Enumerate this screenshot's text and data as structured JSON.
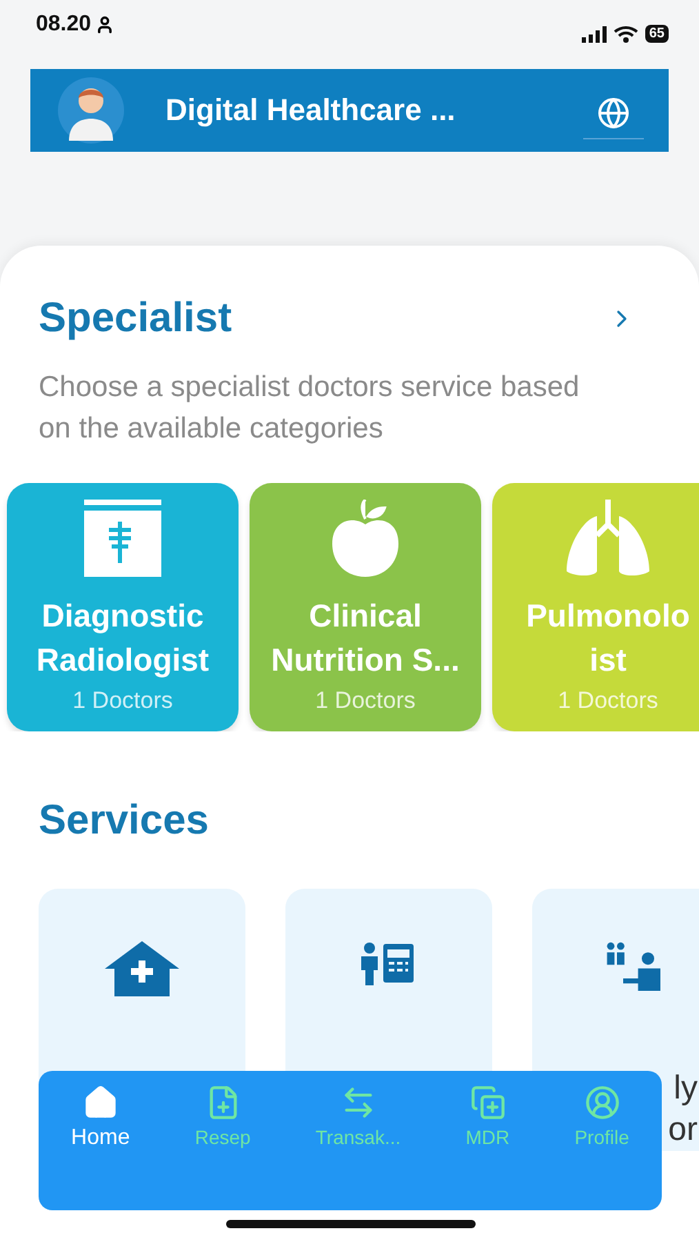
{
  "status_bar": {
    "time": "08.20",
    "battery": "65"
  },
  "header": {
    "title": "Digital Healthcare ..."
  },
  "specialist": {
    "title": "Specialist",
    "description": "Choose a specialist doctors service based on the available categories",
    "categories": [
      {
        "name": "Diagnostic Radiologist",
        "count": "1 Doctors",
        "color": "#1ab4d5",
        "kind": "xray"
      },
      {
        "name": "Clinical Nutrition S...",
        "count": "1 Doctors",
        "color": "#8bc34a",
        "kind": "apple"
      },
      {
        "name": "Pulmonolo\nist",
        "count": "1 Doctors",
        "color": "#c5da3a",
        "kind": "lungs"
      }
    ]
  },
  "services": {
    "title": "Services",
    "items": [
      {
        "kind": "clinic"
      },
      {
        "kind": "kiosk"
      },
      {
        "kind": "consult",
        "label_lines": [
          "ly",
          "or"
        ]
      }
    ]
  },
  "nav": {
    "items": [
      {
        "label": "Home",
        "kind": "home",
        "selected": true
      },
      {
        "label": "Resep",
        "kind": "file",
        "selected": false
      },
      {
        "label": "Transak...",
        "kind": "swap",
        "selected": false
      },
      {
        "label": "MDR",
        "kind": "copy",
        "selected": false
      },
      {
        "label": "Profile",
        "kind": "user",
        "selected": false
      }
    ]
  }
}
